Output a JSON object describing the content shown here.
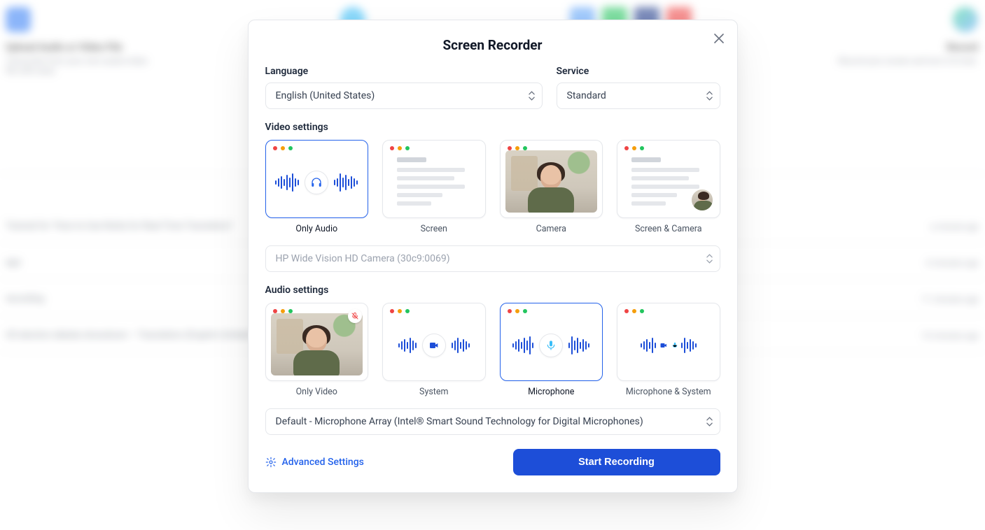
{
  "background": {
    "cards": [
      {
        "title": "Upload Audio or Video File",
        "desc": "Transcribe from your own audio/video file with ease."
      },
      {
        "title": "",
        "desc": ""
      },
      {
        "title": "",
        "desc": ""
      },
      {
        "title": "Record",
        "desc": "Record your screen and turn it to text."
      }
    ],
    "rows": [
      {
        "left": "Tutorial for \"How to Use Notta for Real-Time Translation\"",
        "right": "a minute ago"
      },
      {
        "left": "ago",
        "right": "4 minutes ago"
      },
      {
        "left": "recording",
        "right": "11 minutes ago"
      },
      {
        "left": "US election debate showdown – Translation (English (United States))",
        "right": "14 minutes ago"
      }
    ]
  },
  "modal": {
    "title": "Screen Recorder",
    "language_label": "Language",
    "service_label": "Service",
    "language_value": "English (United States)",
    "service_value": "Standard",
    "video_settings_label": "Video settings",
    "audio_settings_label": "Audio settings",
    "video_options": {
      "only_audio": "Only Audio",
      "screen": "Screen",
      "camera": "Camera",
      "screen_camera": "Screen & Camera"
    },
    "camera_value": "HP Wide Vision HD Camera (30c9:0069)",
    "audio_options": {
      "only_video": "Only Video",
      "system": "System",
      "microphone": "Microphone",
      "mic_system": "Microphone & System"
    },
    "mic_value": "Default - Microphone Array (Intel® Smart Sound Technology for Digital Microphones)",
    "advanced_label": "Advanced Settings",
    "start_label": "Start Recording"
  }
}
